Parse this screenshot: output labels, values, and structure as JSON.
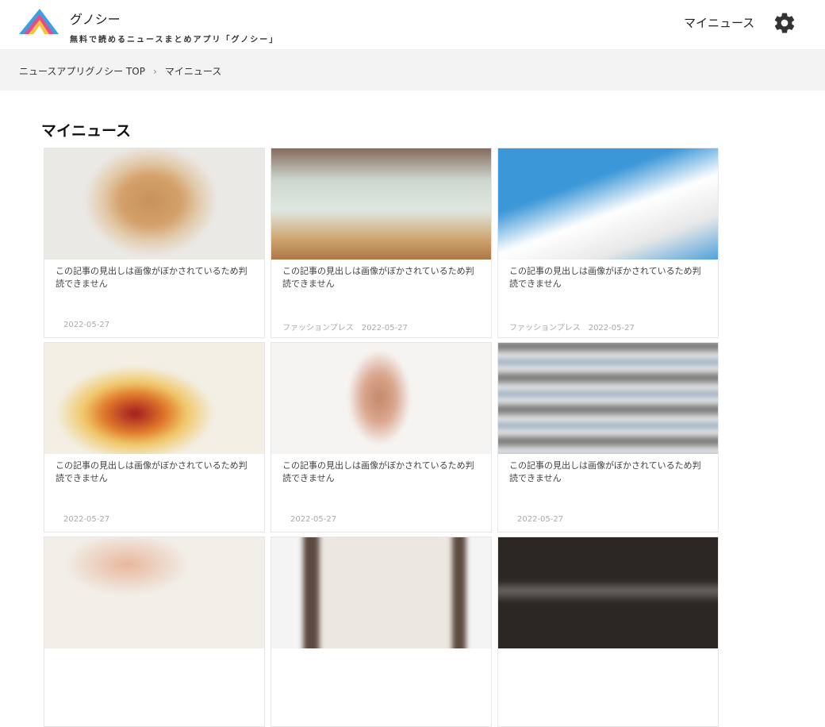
{
  "header": {
    "brand_name": "グノシー",
    "tagline": "無料で読めるニュースまとめアプリ「グノシー」",
    "my_news_link": "マイニュース",
    "settings_icon": "gear-icon"
  },
  "breadcrumb": {
    "items": [
      "ニュースアプリグノシー TOP",
      "マイニュース"
    ],
    "separator": "›"
  },
  "section": {
    "title": "マイニュース"
  },
  "cards": [
    {
      "title": "この記事の見出しは画像がぼかされているため判読できません",
      "source": "",
      "date": "2022-05-27"
    },
    {
      "title": "この記事の見出しは画像がぼかされているため判読できません",
      "source": "ファッションプレス",
      "date": "2022-05-27"
    },
    {
      "title": "この記事の見出しは画像がぼかされているため判読できません",
      "source": "ファッションプレス",
      "date": "2022-05-27"
    },
    {
      "title": "この記事の見出しは画像がぼかされているため判読できません",
      "source": "",
      "date": "2022-05-27"
    },
    {
      "title": "この記事の見出しは画像がぼかされているため判読できません",
      "source": "",
      "date": "2022-05-27"
    },
    {
      "title": "この記事の見出しは画像がぼかされているため判読できません",
      "source": "",
      "date": "2022-05-27"
    },
    {
      "title": "",
      "source": "",
      "date": ""
    },
    {
      "title": "",
      "source": "",
      "date": ""
    },
    {
      "title": "",
      "source": "",
      "date": ""
    }
  ],
  "colors": {
    "header_bg": "#ffffff",
    "breadcrumb_bg": "#f3f3f3",
    "logo_pink": "#e94b8a",
    "logo_blue": "#3aa0e0",
    "logo_yellow": "#f5c23a"
  }
}
